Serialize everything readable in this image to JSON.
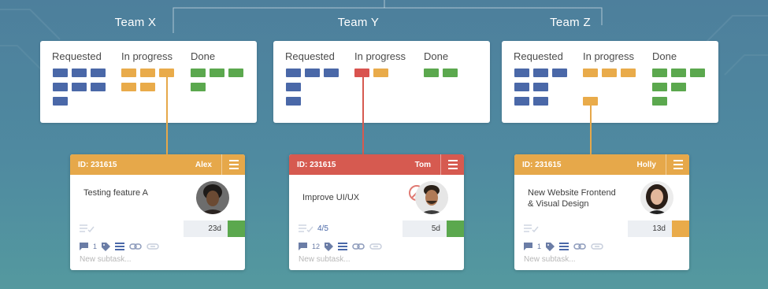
{
  "colors": {
    "blue": "#4a68a8",
    "orange": "#e9ab4a",
    "green": "#5ba84e",
    "red": "#d9534f",
    "header_orange": "#e6a84a",
    "header_red": "#d65a50"
  },
  "teams": [
    {
      "name": "Team X",
      "columns": [
        "Requested",
        "In progress",
        "Done"
      ],
      "task_counts": {
        "requested": 7,
        "in_progress": 5,
        "done": 4
      },
      "card": {
        "id": "ID: 231615",
        "owner": "Alex",
        "title": "Testing feature A",
        "progress": "",
        "days": "23d",
        "comments": "1",
        "subtask_placeholder": "New subtask...",
        "status_color": "#5ba84e"
      }
    },
    {
      "name": "Team Y",
      "columns": [
        "Requested",
        "In progress",
        "Done"
      ],
      "task_counts": {
        "requested": 5,
        "in_progress": 2,
        "done": 2
      },
      "card": {
        "id": "ID: 231615",
        "owner": "Tom",
        "title": "Improve UI/UX",
        "progress": "4/5",
        "days": "5d",
        "comments": "12",
        "subtask_placeholder": "New subtask...",
        "status_color": "#5ba84e",
        "blocked": true
      }
    },
    {
      "name": "Team Z",
      "columns": [
        "Requested",
        "In progress",
        "Done"
      ],
      "task_counts": {
        "requested": 7,
        "in_progress": 4,
        "done": 6
      },
      "card": {
        "id": "ID: 231615",
        "owner": "Holly",
        "title_line1": "New Website Frontend",
        "title_line2": "& Visual Design",
        "progress": "",
        "days": "13d",
        "comments": "1",
        "subtask_placeholder": "New subtask...",
        "status_color": "#e9ab4a"
      }
    }
  ],
  "icons": [
    "checklist-icon",
    "comment-icon",
    "tag-icon",
    "description-icon",
    "link-icon",
    "attachment-icon",
    "menu-icon",
    "blocked-icon"
  ]
}
